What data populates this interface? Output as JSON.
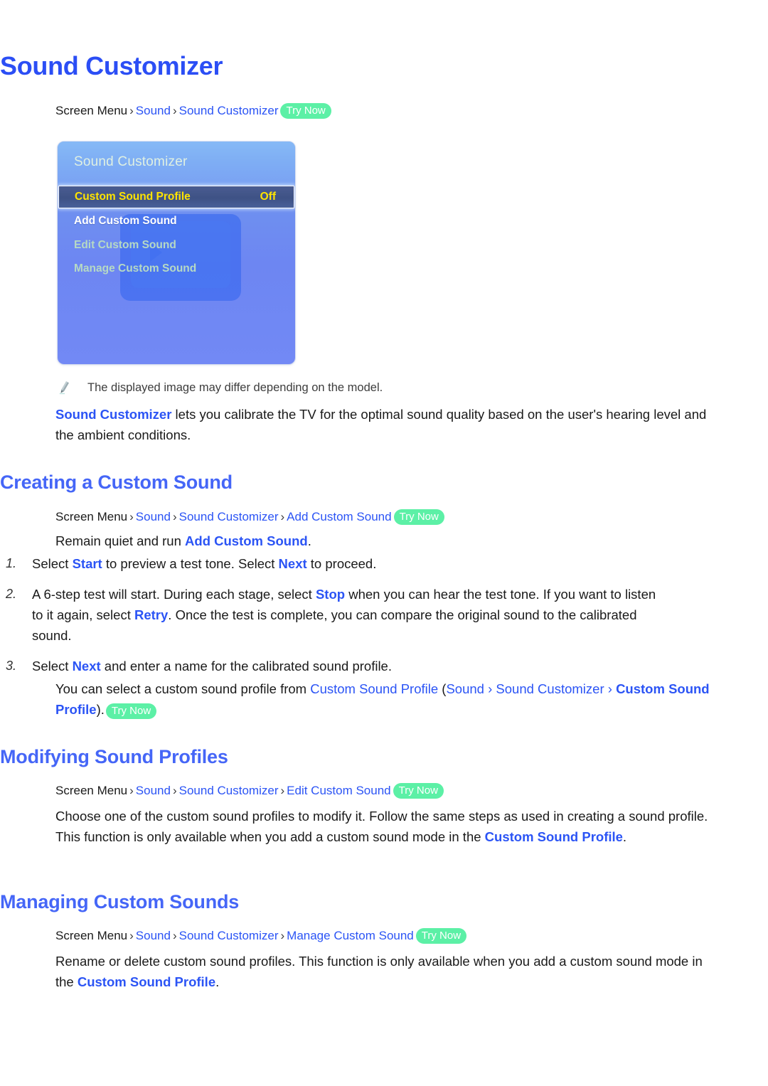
{
  "page": {
    "title": "Sound Customizer"
  },
  "colors": {
    "link_blue": "#2b54f5",
    "heading_blue": "#4566f7",
    "title_blue": "#2b4ef5",
    "trynow_green": "#5cf0a6",
    "tv_highlight_yellow": "#ffe400"
  },
  "breadcrumbs": {
    "main": {
      "root": "Screen Menu",
      "sep": "›",
      "items": [
        "Sound",
        "Sound Customizer"
      ],
      "badge": "Try Now"
    },
    "creating": {
      "root": "Screen Menu",
      "sep": "›",
      "items": [
        "Sound",
        "Sound Customizer",
        "Add Custom Sound"
      ],
      "badge": "Try Now"
    },
    "modifying": {
      "root": "Screen Menu",
      "sep": "›",
      "items": [
        "Sound",
        "Sound Customizer",
        "Edit Custom Sound"
      ],
      "badge": "Try Now"
    },
    "managing": {
      "root": "Screen Menu",
      "sep": "›",
      "items": [
        "Sound",
        "Sound Customizer",
        "Manage Custom Sound"
      ],
      "badge": "Try Now"
    }
  },
  "tv_image": {
    "menu_title": "Sound Customizer",
    "rows": [
      {
        "label": "Custom Sound Profile",
        "value": "Off",
        "state": "selected"
      },
      {
        "label": "Add Custom Sound",
        "value": "",
        "state": "enabled"
      },
      {
        "label": "Edit Custom Sound",
        "value": "",
        "state": "disabled"
      },
      {
        "label": "Manage Custom Sound",
        "value": "",
        "state": "disabled"
      }
    ]
  },
  "note": {
    "icon": "pencil-icon",
    "text": "The displayed image may differ depending on the model."
  },
  "intro": {
    "link": "Sound Customizer",
    "rest": " lets you calibrate the TV for the optimal sound quality based on the user's hearing level and the ambient conditions."
  },
  "sections": {
    "creating": {
      "heading": "Creating a Custom Sound",
      "lead_before": "Remain quiet and run ",
      "lead_link": "Add Custom Sound",
      "lead_after": ".",
      "steps": [
        {
          "num": "1.",
          "parts": [
            {
              "t": "Select ",
              "k": "plain"
            },
            {
              "t": "Start",
              "k": "link"
            },
            {
              "t": " to preview a test tone. Select ",
              "k": "plain"
            },
            {
              "t": "Next",
              "k": "link"
            },
            {
              "t": " to proceed.",
              "k": "plain"
            }
          ]
        },
        {
          "num": "2.",
          "parts": [
            {
              "t": "A 6-step test will start. During each stage, select ",
              "k": "plain"
            },
            {
              "t": "Stop",
              "k": "link"
            },
            {
              "t": " when you can hear the test tone. If you want to listen to it again, select ",
              "k": "plain"
            },
            {
              "t": "Retry",
              "k": "link"
            },
            {
              "t": ". Once the test is complete, you can compare the original sound to the calibrated sound.",
              "k": "plain"
            }
          ]
        },
        {
          "num": "3.",
          "parts": [
            {
              "t": "Select ",
              "k": "plain"
            },
            {
              "t": "Next",
              "k": "link"
            },
            {
              "t": " and enter a name for the calibrated sound profile.",
              "k": "plain"
            }
          ]
        }
      ],
      "closing": {
        "before": "You can select a custom sound profile from ",
        "link1": "Custom Sound Profile",
        "paren_open": " (",
        "link2": "Sound",
        "sep": " › ",
        "link3": "Sound Customizer",
        "link4": "Custom Sound Profile",
        "paren_close": ").",
        "badge": "Try Now"
      }
    },
    "modifying": {
      "heading": "Modifying Sound Profiles",
      "body_before": "Choose one of the custom sound profiles to modify it. Follow the same steps as used in creating a sound profile. This function is only available when you add a custom sound mode in the ",
      "body_link": "Custom Sound Profile",
      "body_after": "."
    },
    "managing": {
      "heading": "Managing Custom Sounds",
      "body_before": "Rename or delete custom sound profiles. This function is only available when you add a custom sound mode in the ",
      "body_link": "Custom Sound Profile",
      "body_after": "."
    }
  }
}
